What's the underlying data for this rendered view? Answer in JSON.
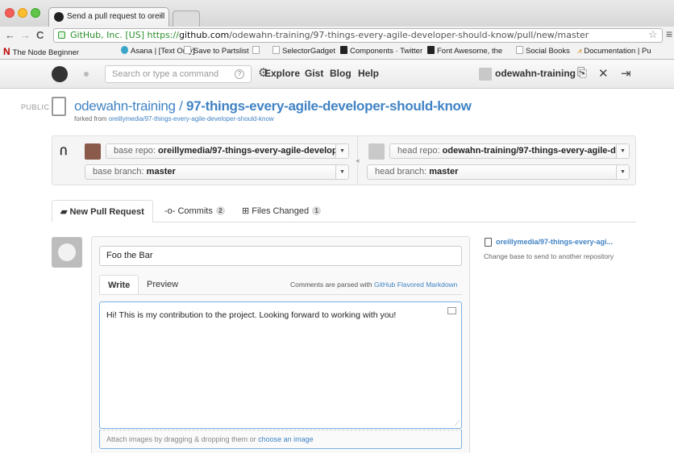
{
  "browser": {
    "tab_title": "Send a pull request to oreill",
    "tab_close": "×",
    "url_ev": "GitHub, Inc. [US]",
    "url_proto": "https://",
    "url_host": "github.com",
    "url_path": "/odewahn-training/97-things-every-agile-developer-should-know/pull/new/master",
    "bookmarks": [
      {
        "label": "The Node Beginner"
      },
      {
        "label": "Asana | [Text Only]"
      },
      {
        "label": "Save to Partslist"
      },
      {
        "label": ""
      },
      {
        "label": "SelectorGadget"
      },
      {
        "label": "Components · Twitter"
      },
      {
        "label": "Font Awesome, the"
      },
      {
        "label": "Social Books"
      },
      {
        "label": "Documentation | Pu"
      }
    ]
  },
  "header": {
    "search_placeholder": "Search or type a command",
    "nav": [
      "Explore",
      "Gist",
      "Blog",
      "Help"
    ],
    "username": "odewahn-training"
  },
  "repo": {
    "visibility": "PUBLIC",
    "owner": "odewahn-training",
    "separator": "/",
    "name": "97-things-every-agile-developer-should-know",
    "forked_prefix": "forked from",
    "forked_from": "oreillymedia/97-things-every-agile-developer-should-know"
  },
  "compare": {
    "base_repo_label": "base repo:",
    "base_repo": "oreillymedia/97-things-every-agile-develop...",
    "base_branch_label": "base branch:",
    "base_branch": "master",
    "head_repo_label": "head repo:",
    "head_repo": "odewahn-training/97-things-every-agile-de...",
    "head_branch_label": "head branch:",
    "head_branch": "master"
  },
  "tabs": [
    {
      "label": "New Pull Request",
      "count": ""
    },
    {
      "label": "Commits",
      "count": "2"
    },
    {
      "label": "Files Changed",
      "count": "1"
    }
  ],
  "form": {
    "title_value": "Foo the Bar",
    "write_tab": "Write",
    "preview_tab": "Preview",
    "md_note_prefix": "Comments are parsed with",
    "md_note_link": "GitHub Flavored Markdown",
    "body_value": "Hi!  This is my contribution to the project.  Looking forward to working with you!",
    "attach_prefix": "Attach images by dragging & dropping them or",
    "attach_link": "choose an image"
  },
  "side": {
    "target_repo": "oreillymedia/97-things-every-agi...",
    "change_base_note": "Change base to send to another repository"
  }
}
